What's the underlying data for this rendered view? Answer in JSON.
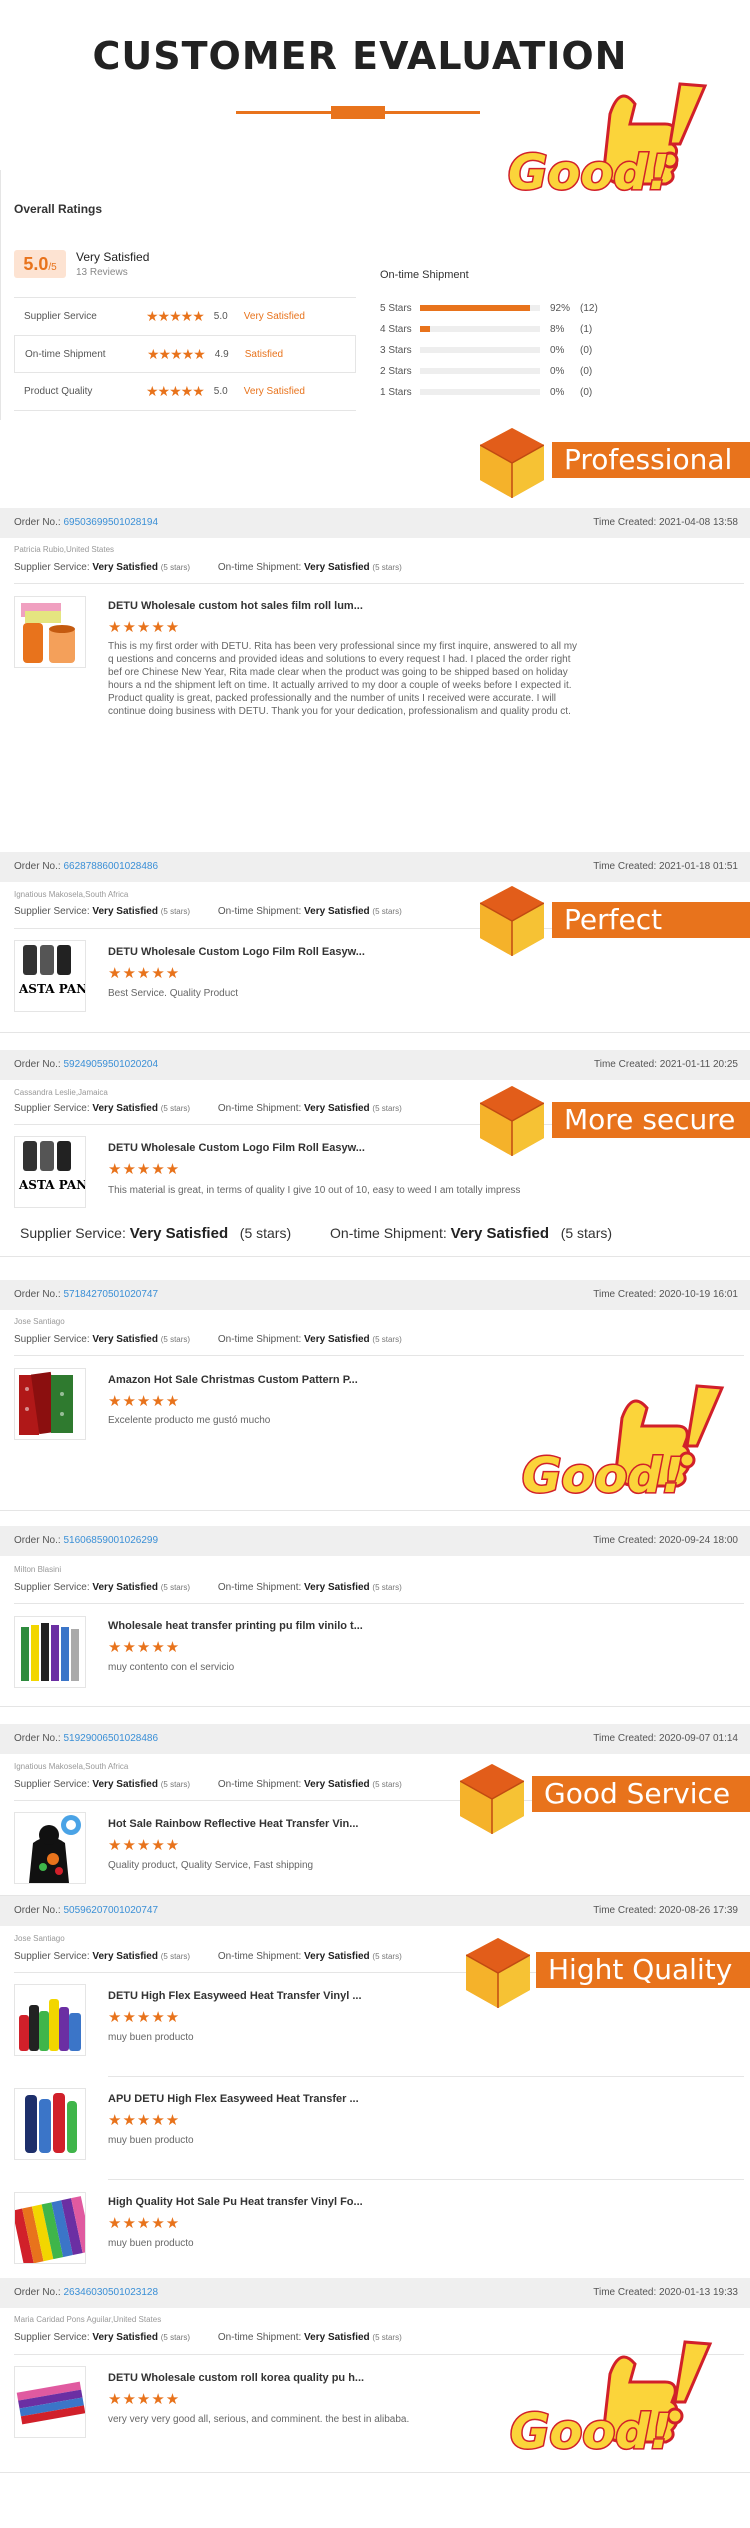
{
  "header": {
    "title": "CUSTOMER EVALUATION",
    "good_text": "Good!"
  },
  "ratings": {
    "title": "Overall Ratings",
    "score": "5.0",
    "score_max": "/5",
    "summary": "Very Satisfied",
    "review_count": "13 Reviews",
    "rows": [
      {
        "label": "Supplier Service",
        "stars": "★★★★★",
        "value": "5.0",
        "text": "Very Satisfied"
      },
      {
        "label": "On-time Shipment",
        "stars": "★★★★★",
        "value": "4.9",
        "text": "Satisfied"
      },
      {
        "label": "Product Quality",
        "stars": "★★★★★",
        "value": "5.0",
        "text": "Very Satisfied"
      }
    ],
    "shipment_title": "On-time Shipment",
    "bars": [
      {
        "label": "5 Stars",
        "pct": "92%",
        "count": "(12)",
        "fraction": 0.92
      },
      {
        "label": "4 Stars",
        "pct": "8%",
        "count": "(1)",
        "fraction": 0.08
      },
      {
        "label": "3 Stars",
        "pct": "0%",
        "count": "(0)",
        "fraction": 0
      },
      {
        "label": "2 Stars",
        "pct": "0%",
        "count": "(0)",
        "fraction": 0
      },
      {
        "label": "1 Stars",
        "pct": "0%",
        "count": "(0)",
        "fraction": 0
      }
    ]
  },
  "badges": {
    "professional": "Professional",
    "perfect": "Perfect",
    "more_secure": "More secure",
    "good_service": "Good Service",
    "hight_quality": "Hight Quality"
  },
  "common": {
    "order_no_label": "Order No.:",
    "time_label": "Time Created:",
    "supplier_label": "Supplier Service:",
    "shipment_label": "On-time Shipment:",
    "very_satisfied": "Very Satisfied",
    "five_stars": "(5 stars)",
    "stars": "★★★★★"
  },
  "orders": [
    {
      "no": "69503699501028194",
      "time": "2021-04-08 13:58",
      "buyer": "Patricia Rubio,United States",
      "product": "DETU Wholesale custom hot sales film roll lum...",
      "comment": "This is my first order with DETU. Rita has been very professional since my first inquire, answered to all my q uestions and concerns and provided ideas and solutions to every request I had. I placed the order right bef ore Chinese New Year, Rita made clear when the product was going to be shipped based on holiday hours a nd the shipment left on time. It actually arrived to my door a couple of weeks before I expected it. Product quality is great, packed professionally and the number of units I received were accurate. I will continue doing business with DETU. Thank you for your dedication, professionalism and quality produ ct."
    },
    {
      "no": "66287886001028486",
      "time": "2021-01-18 01:51",
      "buyer": "Ignatious Makosela,South Africa",
      "product": "DETU Wholesale Custom Logo Film Roll Easyw...",
      "comment": "Best Service. Quality Product"
    },
    {
      "no": "59249059501020204",
      "time": "2021-01-11 20:25",
      "buyer": "Cassandra Leslie,Jamaica",
      "product": "DETU Wholesale Custom Logo Film Roll Easyw...",
      "comment": "This material is great, in terms of quality I give 10 out of 10, easy to weed I am totally impress"
    },
    {
      "no": "57184270501020747",
      "time": "2020-10-19 16:01",
      "buyer": "Jose Santiago",
      "product": "Amazon Hot Sale Christmas Custom Pattern P...",
      "comment": "Excelente producto me gustó mucho"
    },
    {
      "no": "51606859001026299",
      "time": "2020-09-24 18:00",
      "buyer": "Milton Blasini",
      "product": "Wholesale heat transfer printing pu film vinilo t...",
      "comment": "muy contento con el servicio"
    },
    {
      "no": "51929006501028486",
      "time": "2020-09-07 01:14",
      "buyer": "Ignatious Makosela,South Africa",
      "product": "Hot Sale Rainbow Reflective Heat Transfer Vin...",
      "comment": "Quality product, Quality Service, Fast shipping"
    },
    {
      "no": "50596207001020747",
      "time": "2020-08-26 17:39",
      "buyer": "Jose Santiago",
      "items": [
        {
          "product": "DETU High Flex Easyweed Heat Transfer Vinyl ...",
          "comment": "muy buen producto"
        },
        {
          "product": "APU DETU High Flex Easyweed Heat Transfer ...",
          "comment": "muy buen producto"
        },
        {
          "product": "High Quality Hot Sale Pu Heat transfer Vinyl Fo...",
          "comment": "muy buen producto"
        }
      ]
    },
    {
      "no": "26346030501023128",
      "time": "2020-01-13 19:33",
      "buyer": "Maria Caridad Pons Aguilar,United States",
      "product": "DETU Wholesale custom roll korea quality pu h...",
      "comment": "very very very good all, serious, and comminent. the best in alibaba."
    }
  ],
  "thumb_texts": {
    "asta": "ASTA PANT!"
  },
  "colors": {
    "accent": "#e8731c",
    "link": "#3a8fd6",
    "gold": "#fbd43a",
    "red": "#d1202a"
  }
}
